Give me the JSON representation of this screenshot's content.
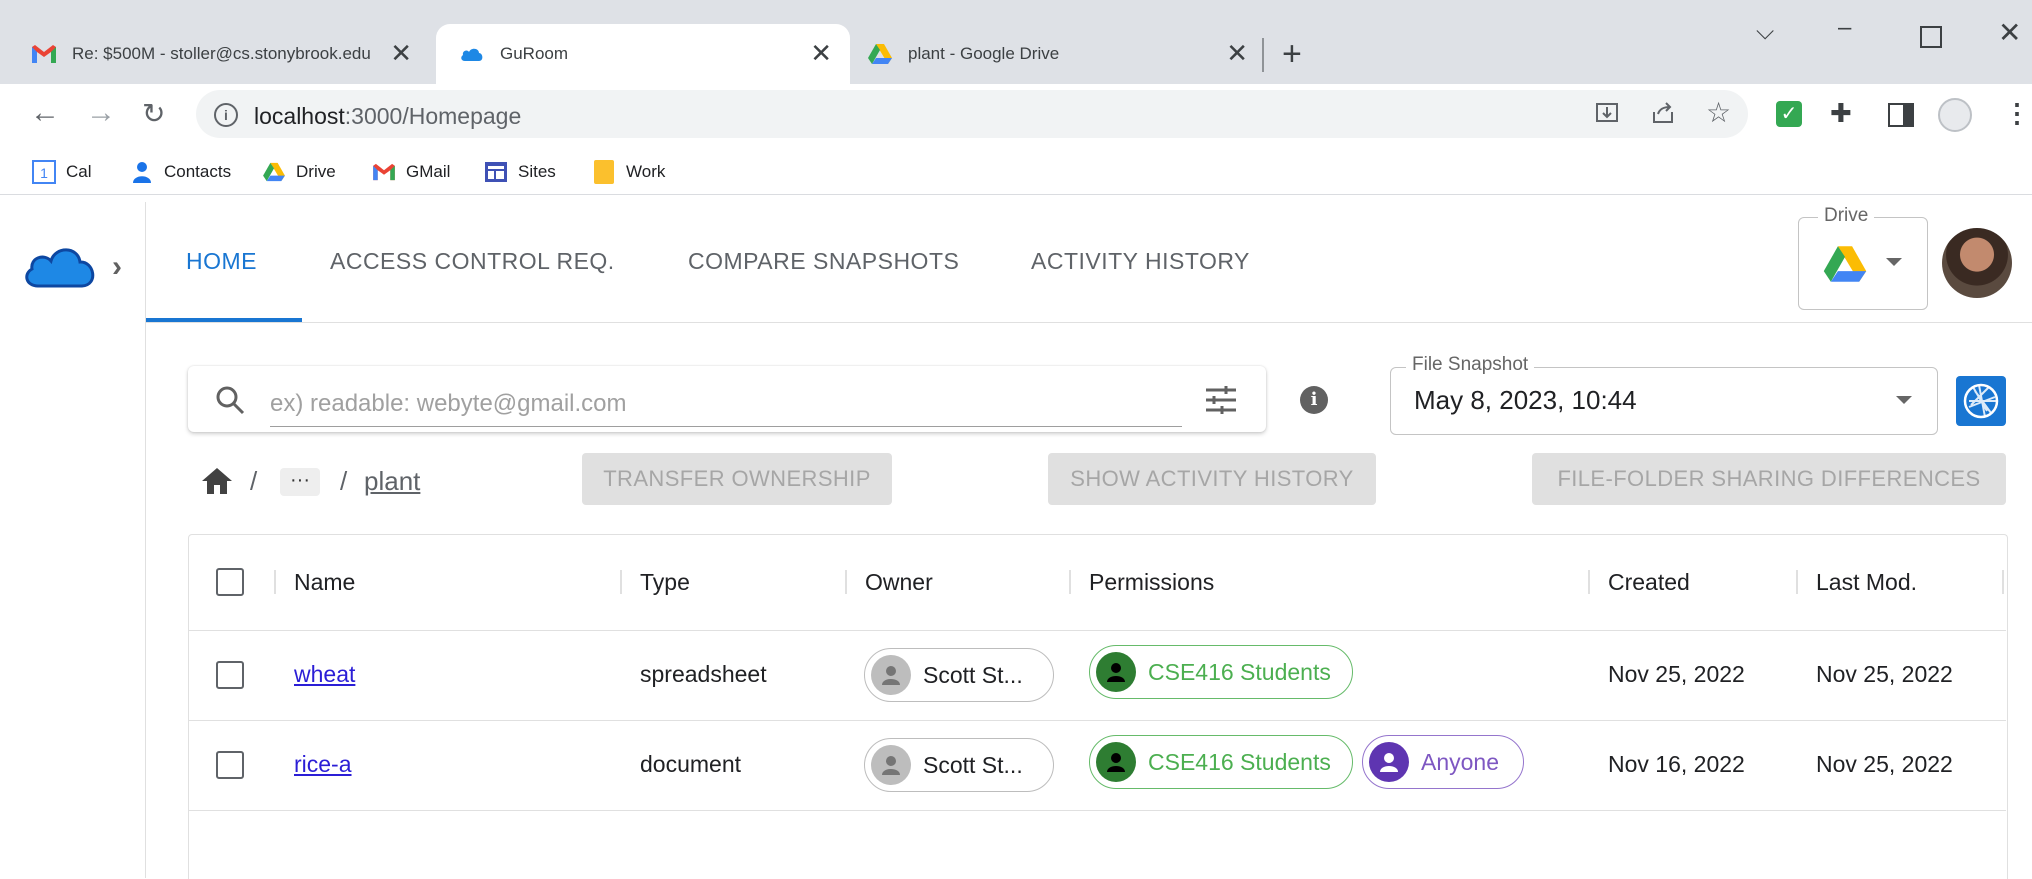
{
  "browser": {
    "tabs": [
      {
        "title": "Re: $500M - stoller@cs.stonybrook.edu",
        "icon": "gmail-icon"
      },
      {
        "title": "GuRoom",
        "icon": "cloud-icon"
      },
      {
        "title": "plant - Google Drive",
        "icon": "google-drive-icon"
      }
    ],
    "url_host": "localhost",
    "url_path": ":3000/Homepage",
    "bookmarks": [
      "Cal",
      "Contacts",
      "Drive",
      "GMail",
      "Sites",
      "Work"
    ]
  },
  "app": {
    "nav_tabs": [
      "HOME",
      "ACCESS CONTROL REQ.",
      "COMPARE SNAPSHOTS",
      "ACTIVITY HISTORY"
    ],
    "active_tab": "HOME",
    "drive_selector_label": "Drive",
    "accent": "#1976d2"
  },
  "search": {
    "placeholder": "ex) readable: webyte@gmail.com",
    "value": ""
  },
  "snapshot": {
    "label": "File Snapshot",
    "value": "May 8, 2023, 10:44"
  },
  "breadcrumb": {
    "separator": "/",
    "more": "···",
    "current": "plant"
  },
  "actions": {
    "transfer": "TRANSFER OWNERSHIP",
    "activity": "SHOW ACTIVITY HISTORY",
    "sharing_diff": "FILE-FOLDER SHARING DIFFERENCES"
  },
  "table": {
    "headers": {
      "name": "Name",
      "type": "Type",
      "owner": "Owner",
      "permissions": "Permissions",
      "created": "Created",
      "modified": "Last Mod."
    },
    "rows": [
      {
        "name": "wheat",
        "type": "spreadsheet",
        "owner": "Scott St...",
        "permissions": [
          "CSE416 Students"
        ],
        "created": "Nov 25, 2022",
        "modified": "Nov 25, 2022"
      },
      {
        "name": "rice-a",
        "type": "document",
        "owner": "Scott St...",
        "permissions": [
          "CSE416 Students",
          "Anyone"
        ],
        "created": "Nov 16, 2022",
        "modified": "Nov 25, 2022"
      }
    ]
  }
}
